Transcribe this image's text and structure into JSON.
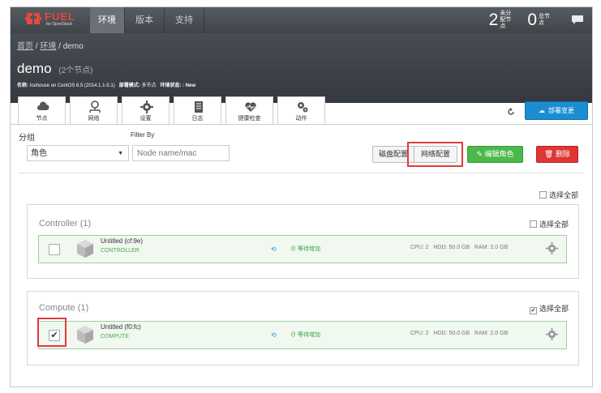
{
  "topnav": {
    "logo": {
      "brand": "FUEL",
      "tagline": "for OpenStack"
    },
    "tabs": [
      {
        "label": "环境",
        "active": true
      },
      {
        "label": "版本",
        "active": false
      },
      {
        "label": "支持",
        "active": false
      }
    ],
    "counts": [
      {
        "value": "2",
        "label": "未分配节点"
      },
      {
        "value": "0",
        "label": "总节点"
      }
    ]
  },
  "breadcrumb": {
    "home": "首页",
    "sep1": "/",
    "env_link": "环境",
    "sep2": "/",
    "current": "demo"
  },
  "environment": {
    "name": "demo",
    "node_count": "(2个节点)",
    "info_name_label": "名称:",
    "info_name_value": "Icehouse on CentOS 6.5 (2014.1.1-5.1)",
    "info_mode_label": "部署模式:",
    "info_mode_value": "多节点",
    "info_status_label": "环境状态:",
    "info_status_value": ": New"
  },
  "subtabs": [
    {
      "label": "节点",
      "icon": "cloud-icon",
      "active": true
    },
    {
      "label": "网络",
      "icon": "network-icon",
      "active": false
    },
    {
      "label": "设置",
      "icon": "gear-icon",
      "active": false
    },
    {
      "label": "日志",
      "icon": "document-icon",
      "active": false
    },
    {
      "label": "健康检查",
      "icon": "heart-icon",
      "active": false
    },
    {
      "label": "动作",
      "icon": "gears-icon",
      "active": false
    }
  ],
  "deploy_button": "部署变更",
  "toolbar": {
    "group_label": "分组",
    "group_select_value": "角色",
    "filter_label": "Filter By",
    "filter_placeholder": "Node name/mac",
    "disk_config": "磁盘配置",
    "net_config": "网络配置",
    "edit_roles": "编辑角色",
    "delete": "删除"
  },
  "select_all_label": "选择全部",
  "groups": [
    {
      "title": "Controller (1)",
      "select_all": "选择全部",
      "select_all_checked": false,
      "nodes": [
        {
          "name": "Untitled (cf:9e)",
          "role": "CONTROLLER",
          "status": "等待增加",
          "cpu": "CPU: 2",
          "hdd": "HDD: 50.0 GB",
          "ram": "RAM: 2.0 GB",
          "checked": false
        }
      ]
    },
    {
      "title": "Compute (1)",
      "select_all": "选择全部",
      "select_all_checked": true,
      "nodes": [
        {
          "name": "Untitled (f0:fc)",
          "role": "COMPUTE",
          "status": "等待增加",
          "cpu": "CPU: 2",
          "hdd": "HDD: 50.0 GB",
          "ram": "RAM: 2.0 GB",
          "checked": true
        }
      ]
    }
  ],
  "colors": {
    "accent_blue": "#1b8ed1",
    "success_green": "#4cb84c",
    "danger_red": "#e03535",
    "highlight_red": "#e23b3b"
  }
}
